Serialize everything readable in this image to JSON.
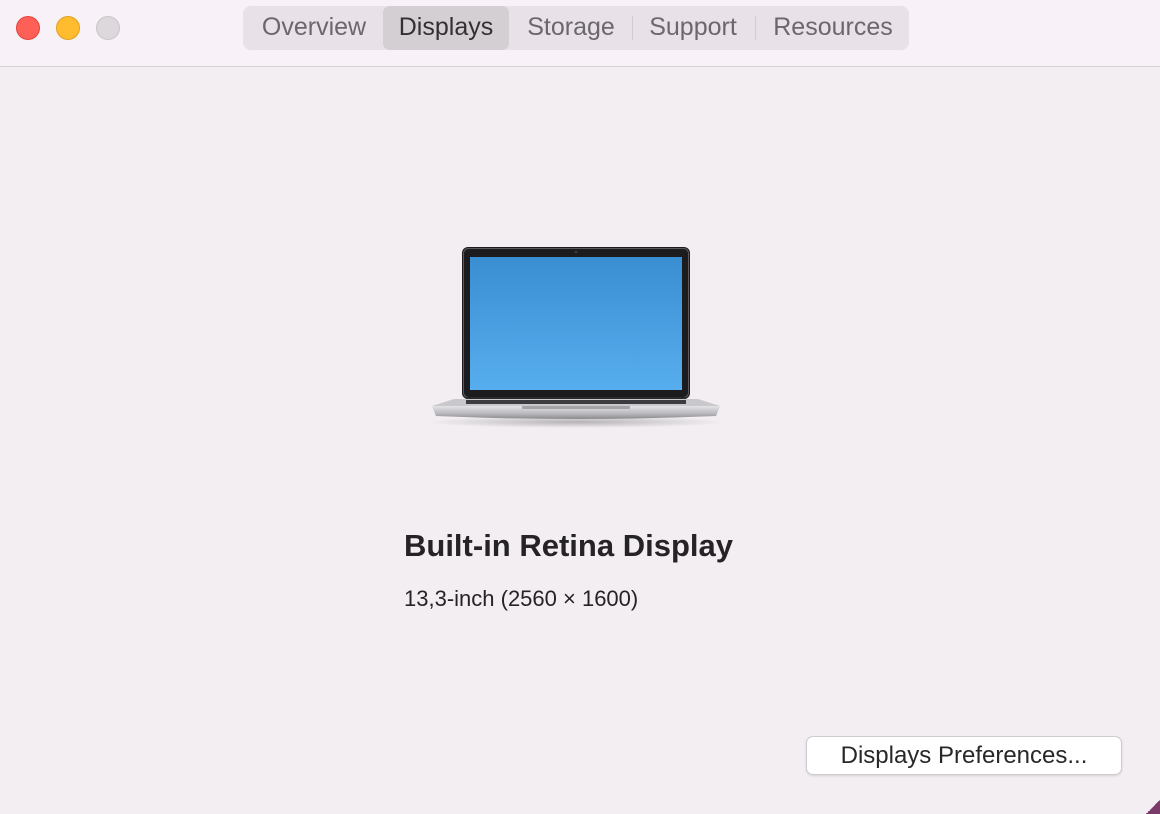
{
  "window": {
    "tabs": [
      {
        "label": "Overview",
        "selected": false
      },
      {
        "label": "Displays",
        "selected": true
      },
      {
        "label": "Storage",
        "selected": false
      },
      {
        "label": "Support",
        "selected": false
      },
      {
        "label": "Resources",
        "selected": false
      }
    ]
  },
  "display": {
    "icon": "laptop-icon",
    "name": "Built-in Retina Display",
    "spec": "13,3-inch (2560 × 1600)"
  },
  "actions": {
    "preferences_label": "Displays Preferences..."
  },
  "colors": {
    "close": "#fe5f57",
    "minimize": "#febc2e",
    "zoom": "#dcd8dc",
    "screen_top": "#3a8ed2",
    "screen_bottom": "#57aeee"
  }
}
